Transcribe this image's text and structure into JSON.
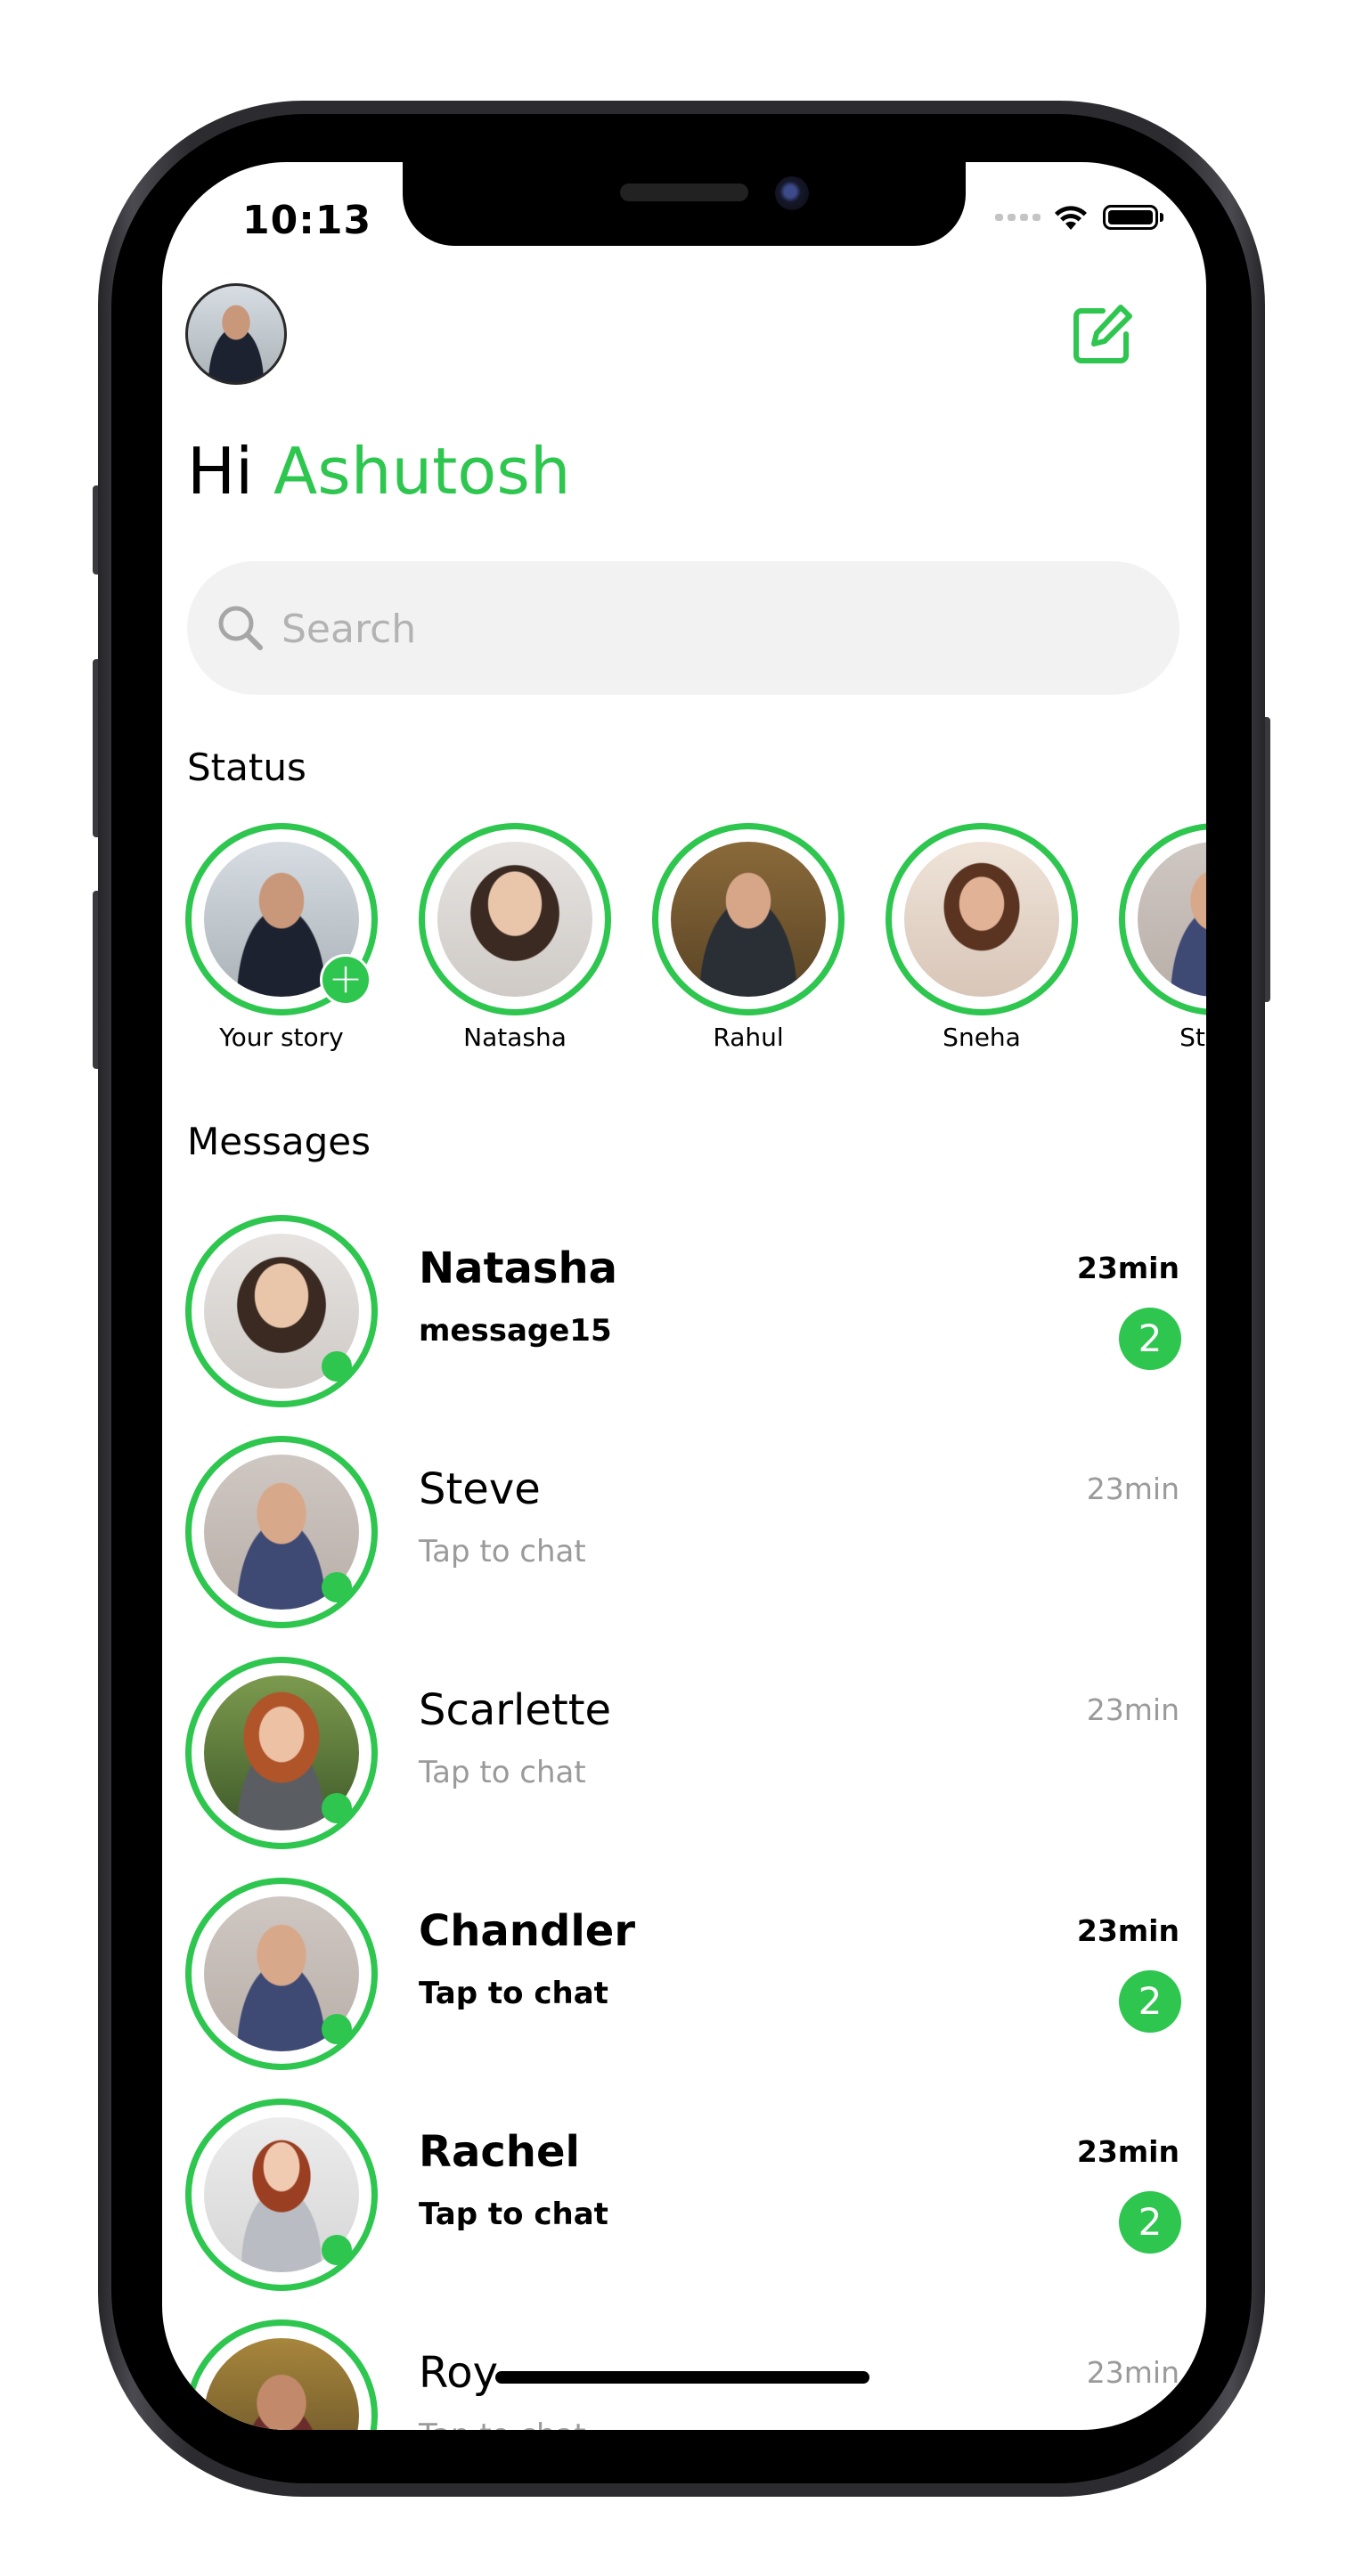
{
  "status_bar": {
    "time": "10:13"
  },
  "header": {
    "greeting_prefix": "Hi",
    "user_name": "Ashutosh",
    "profile_icon": "profile-avatar",
    "compose_icon": "compose-icon"
  },
  "search": {
    "placeholder": "Search",
    "value": ""
  },
  "status_section": {
    "title": "Status",
    "stories": [
      {
        "label": "Your story",
        "add": true
      },
      {
        "label": "Natasha"
      },
      {
        "label": "Rahul"
      },
      {
        "label": "Sneha"
      },
      {
        "label": "Steve"
      }
    ]
  },
  "messages_section": {
    "title": "Messages",
    "chats": [
      {
        "name": "Natasha",
        "preview": "message15",
        "time": "23min",
        "unread": "2",
        "online": true
      },
      {
        "name": "Steve",
        "preview": "Tap to chat",
        "time": "23min",
        "online": true
      },
      {
        "name": "Scarlette",
        "preview": "Tap to chat",
        "time": "23min",
        "online": true
      },
      {
        "name": "Chandler",
        "preview": "Tap to chat",
        "time": "23min",
        "unread": "2",
        "online": true
      },
      {
        "name": "Rachel",
        "preview": "Tap to chat",
        "time": "23min",
        "unread": "2",
        "online": true
      },
      {
        "name": "Roy",
        "preview": "Tap to chat",
        "time": "23min"
      }
    ]
  },
  "colors": {
    "accent": "#2ec64f",
    "muted_text": "#9a9a9a",
    "search_bg": "#f2f2f2"
  }
}
